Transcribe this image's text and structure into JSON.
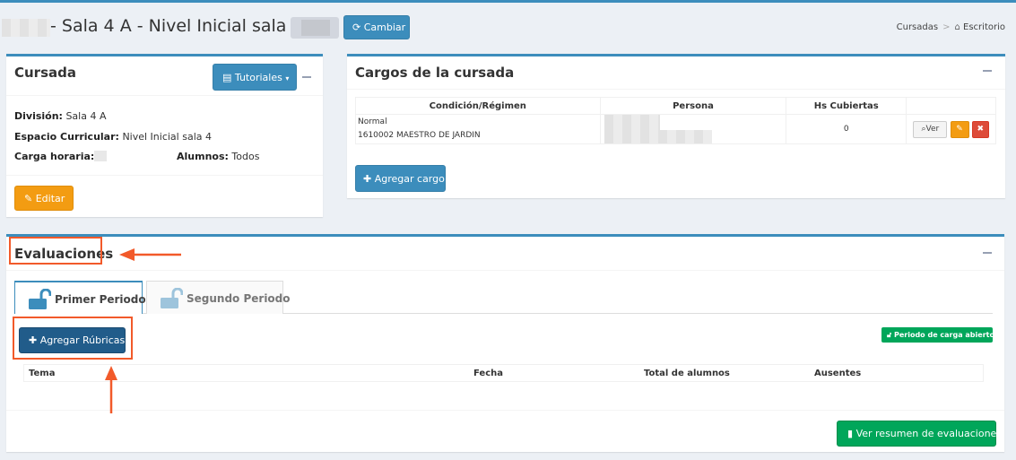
{
  "header": {
    "title": "- Sala 4 A - Nivel Inicial sala 4 -",
    "change_button": "Cambiar",
    "breadcrumb": {
      "item1": "Cursadas",
      "sep": ">",
      "item2": "Escritorio"
    }
  },
  "cursada": {
    "title": "Cursada",
    "tutoriales_button": "Tutoriales",
    "division_label": "División:",
    "division_value": "Sala 4 A",
    "espacio_label": "Espacio Curricular:",
    "espacio_value": "Nivel Inicial sala 4",
    "carga_label": "Carga horaria:",
    "alumnos_label": "Alumnos:",
    "alumnos_value": "Todos",
    "edit_button": "Editar"
  },
  "cargos": {
    "title": "Cargos de la cursada",
    "columns": [
      "Condición/Régimen",
      "Persona",
      "Hs Cubiertas",
      ""
    ],
    "rows": [
      {
        "condicion": "Normal",
        "regimen": "1610002 MAESTRO DE JARDIN",
        "hs": "0",
        "ver_label": "Ver"
      }
    ],
    "add_button": "Agregar cargo"
  },
  "evaluaciones": {
    "title": "Evaluaciones",
    "tabs": [
      {
        "label": "Primer Periodo",
        "active": true
      },
      {
        "label": "Segundo Periodo",
        "active": false
      }
    ],
    "add_rubricas_button": "Agregar Rúbricas",
    "status_badge": "Periodo de carga abierto",
    "columns": [
      "Tema",
      "Fecha",
      "Total de alumnos",
      "Ausentes"
    ],
    "resumen_button": "Ver resumen de evaluaciones"
  },
  "colors": {
    "primary": "#3c8dbc",
    "warning": "#f39c12",
    "success": "#00a65a",
    "danger": "#dd4b39",
    "annotation": "#f25a2a"
  }
}
